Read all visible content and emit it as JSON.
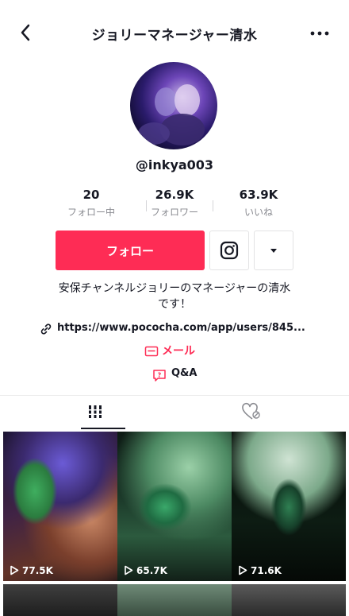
{
  "header": {
    "title": "ジョリーマネージャー清水",
    "back_icon": "chevron-left-icon",
    "more_icon": "more-dots-icon"
  },
  "profile": {
    "username": "@inkya003",
    "stats": [
      {
        "value": "20",
        "label": "フォロー中"
      },
      {
        "value": "26.9K",
        "label": "フォロワー"
      },
      {
        "value": "63.9K",
        "label": "いいね"
      }
    ],
    "follow_label": "フォロー",
    "bio_line1": "安保チャンネルジョリーのマネージャーの清水",
    "bio_line2": "です！",
    "link": "https://www.pococha.com/app/users/845...",
    "mail_label": "メール",
    "qa_label": "Q&A"
  },
  "tabs": [
    {
      "name": "videos",
      "icon": "grid-icon",
      "active": true
    },
    {
      "name": "liked",
      "icon": "liked-hidden-icon",
      "active": false
    }
  ],
  "videos": [
    {
      "views": "77.5K"
    },
    {
      "views": "65.7K"
    },
    {
      "views": "71.6K"
    }
  ],
  "colors": {
    "accent": "#fe2c55",
    "text": "#161823",
    "muted": "#8a8b91"
  }
}
